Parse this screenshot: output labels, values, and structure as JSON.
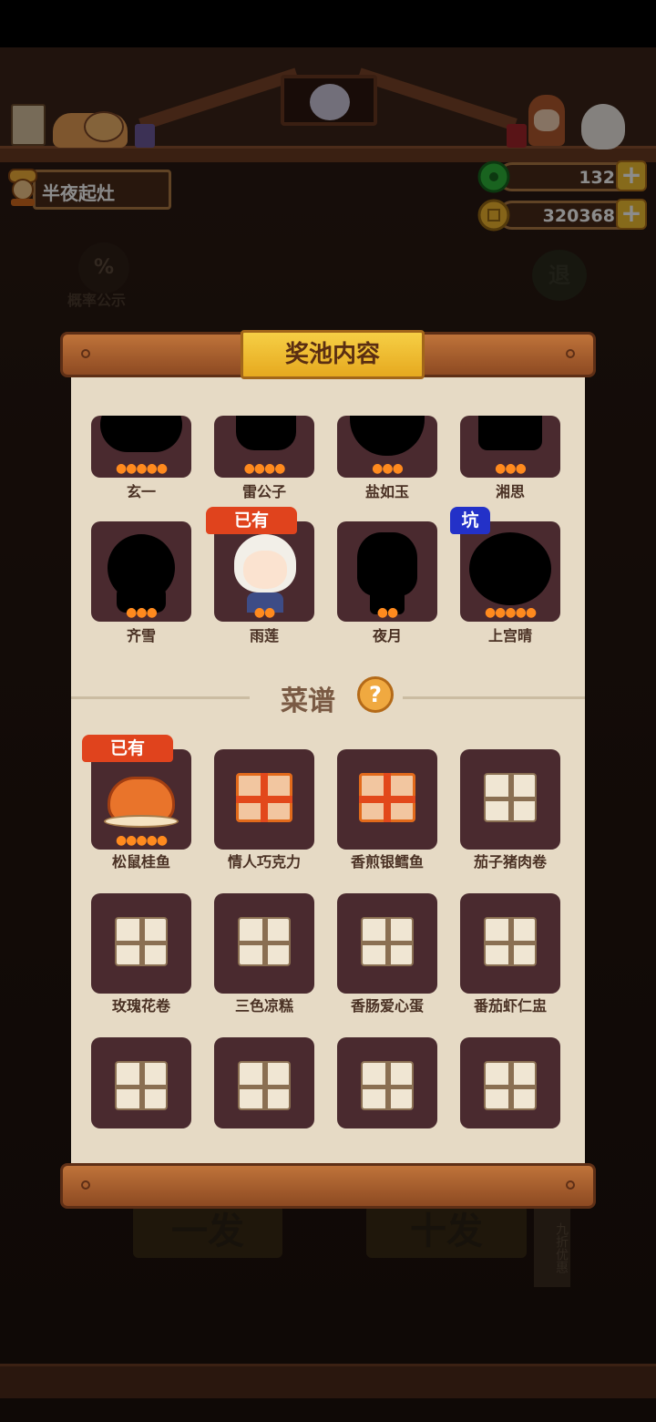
{
  "player": {
    "name": "半夜起灶",
    "icon": "chef-icon"
  },
  "currencies": [
    {
      "name": "jade",
      "value": "132",
      "color": "#2fb43a",
      "icon": "jade-icon"
    },
    {
      "name": "coin",
      "value": "320368",
      "color": "#f2b62f",
      "icon": "coin-icon"
    }
  ],
  "plus_symbol": "+",
  "probability": {
    "icon_text": "%",
    "label": "概率公示"
  },
  "exit": {
    "label": "退"
  },
  "modal": {
    "title": "奖池内容",
    "characters": [
      {
        "name": "玄一",
        "stars": "●●●●●"
      },
      {
        "name": "雷公子",
        "stars": "●●●●"
      },
      {
        "name": "盐如玉",
        "stars": "●●●"
      },
      {
        "name": "湘思",
        "stars": "●●●"
      },
      {
        "name": "齐雪",
        "stars": "●●●"
      },
      {
        "name": "雨莲",
        "stars": "●●",
        "badge": "已有"
      },
      {
        "name": "夜月",
        "stars": "●●"
      },
      {
        "name": "上宫晴",
        "stars": "●●●●●",
        "badge": "坑"
      }
    ],
    "recipe_section": {
      "title": "菜谱",
      "help": "?"
    },
    "recipes": [
      {
        "name": "松鼠桂鱼",
        "badge": "已有",
        "stars": "●●●●●"
      },
      {
        "name": "情人巧克力"
      },
      {
        "name": "香煎银鳕鱼"
      },
      {
        "name": "茄子猪肉卷"
      },
      {
        "name": "玫瑰花卷"
      },
      {
        "name": "三色凉糕"
      },
      {
        "name": "香肠爱心蛋"
      },
      {
        "name": "番茄虾仁盅"
      },
      {
        "name": ""
      },
      {
        "name": ""
      },
      {
        "name": ""
      },
      {
        "name": ""
      }
    ]
  },
  "bottom": {
    "single": "一发",
    "ten": "十发",
    "discount": "九折优惠"
  },
  "colors": {
    "accent": "#e0431d",
    "pit": "#2331c8",
    "gold": "#f5c232"
  }
}
